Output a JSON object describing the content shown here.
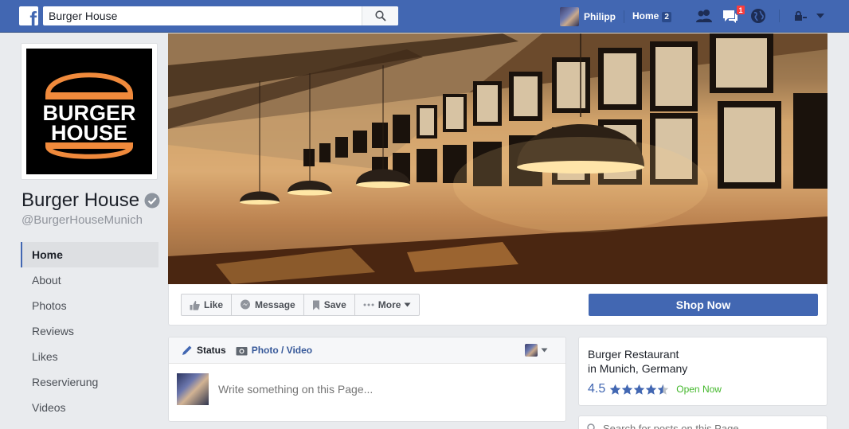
{
  "topbar": {
    "search_value": "Burger House",
    "user_name": "Philipp",
    "home_label": "Home",
    "home_count": "2",
    "messages_badge": "1",
    "icons": [
      "facebook-logo",
      "search-icon",
      "friend-requests-icon",
      "messages-icon",
      "globe-icon",
      "lock-icon",
      "caret-down-icon"
    ],
    "brand_color": "#4267b2"
  },
  "page": {
    "name": "Burger House",
    "handle": "@BurgerHouseMunich",
    "logo_text_top": "BURGER",
    "logo_text_bottom": "HOUSE",
    "logo_color": "#f08a3c"
  },
  "left_nav": {
    "items": [
      {
        "label": "Home"
      },
      {
        "label": "About"
      },
      {
        "label": "Photos"
      },
      {
        "label": "Reviews"
      },
      {
        "label": "Likes"
      },
      {
        "label": "Reservierung"
      },
      {
        "label": "Videos"
      }
    ]
  },
  "actions": {
    "like": "Like",
    "message": "Message",
    "save": "Save",
    "more": "More",
    "shop_now": "Shop Now"
  },
  "composer": {
    "tab_status": "Status",
    "tab_photo": "Photo / Video",
    "placeholder": "Write something on this Page..."
  },
  "about": {
    "category": "Burger Restaurant",
    "location": "in Munich, Germany",
    "rating": "4.5",
    "stars": 4.5,
    "open_status": "Open Now"
  },
  "page_search": {
    "placeholder": "Search for posts on this Page"
  }
}
